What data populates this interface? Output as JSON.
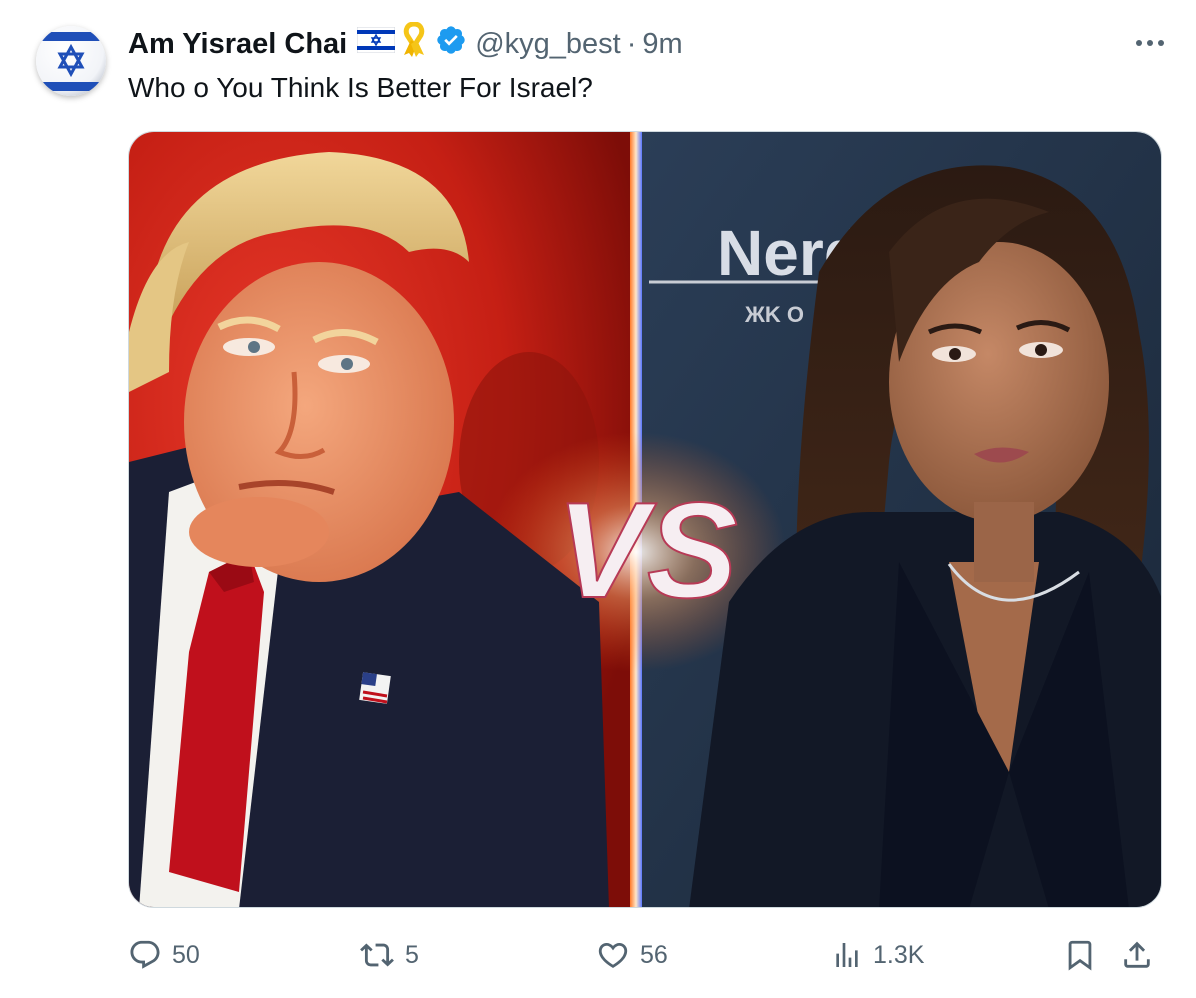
{
  "tweet": {
    "author_name": "Am Yisrael Chai",
    "handle": "@kyg_best",
    "separator": "·",
    "time": "9m",
    "text": "Who o You Think Is Better For Israel?",
    "media": {
      "vs_text": "VS",
      "backdrop_text": "Nerd",
      "backdrop_subtext": "ЖK  O"
    }
  },
  "actions": {
    "replies": "50",
    "retweets": "5",
    "likes": "56",
    "views": "1.3K"
  },
  "colors": {
    "verified": "#1d9bf0",
    "secondary_text": "#536471",
    "primary_text": "#0f1419",
    "flag_blue": "#0038b8",
    "ribbon": "#f5c518"
  },
  "icons": [
    "israel-flag-avatar",
    "israel-flag-icon",
    "yellow-ribbon-icon",
    "verified-badge-icon",
    "more-icon",
    "reply-icon",
    "retweet-icon",
    "like-icon",
    "views-icon",
    "bookmark-icon",
    "share-icon"
  ]
}
